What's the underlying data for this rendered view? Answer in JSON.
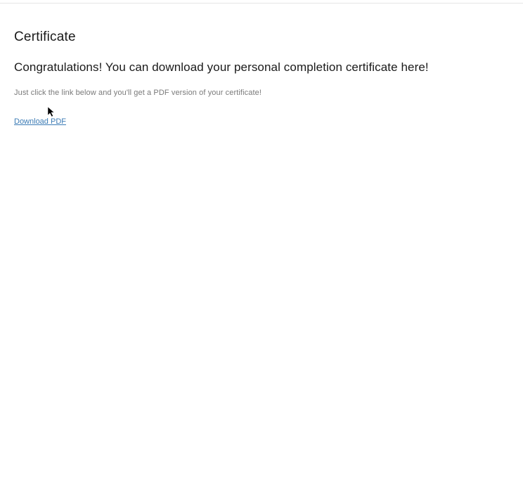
{
  "page": {
    "title": "Certificate",
    "subtitle": "Congratulations! You can download your personal completion certificate here!",
    "description": "Just click the link below and you'll get a PDF version of your certificate!",
    "download_link_label": "Download PDF"
  }
}
